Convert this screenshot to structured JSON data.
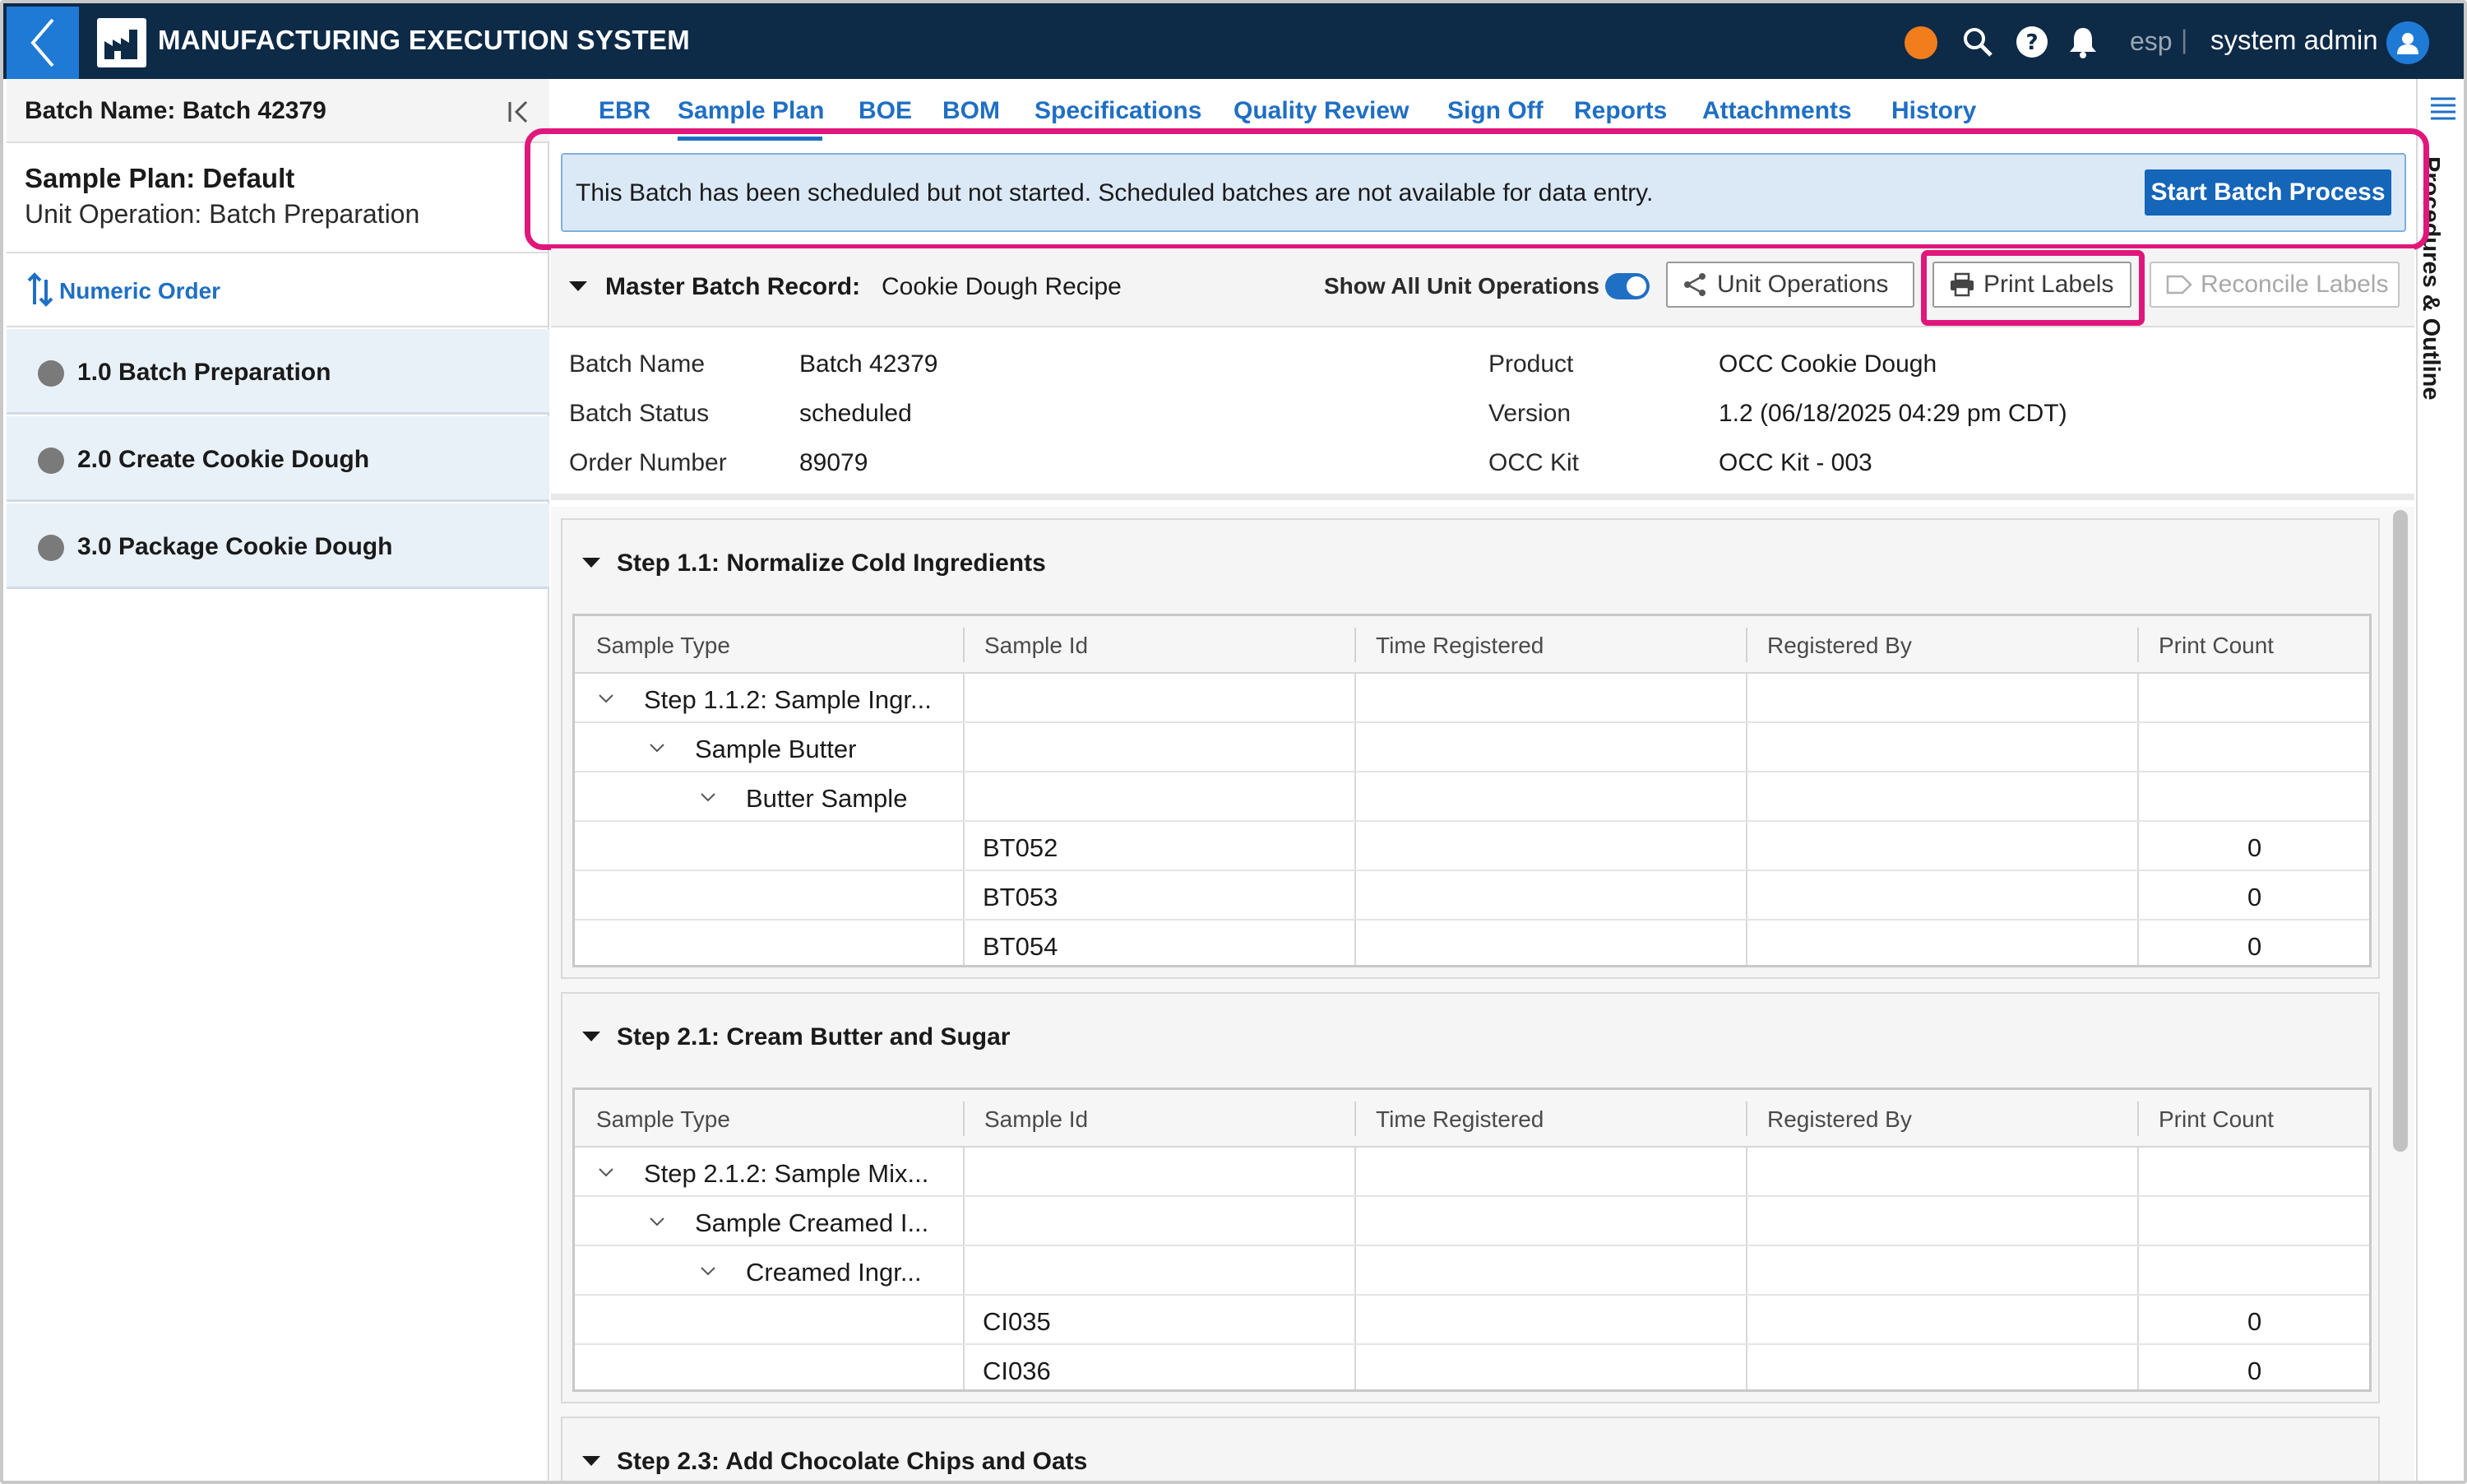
{
  "app": {
    "title": "MANUFACTURING EXECUTION SYSTEM",
    "status_color": "#f27d1d",
    "accent": "#1f6fc4",
    "brand_dark": "#0d2a47"
  },
  "topbar": {
    "language": "esp",
    "separator": "|",
    "user": "system admin",
    "icons": [
      "search-icon",
      "help-icon",
      "bell-icon",
      "user-icon"
    ]
  },
  "sidebar": {
    "batch_name": "Batch Name: Batch 42379",
    "plan_title": "Sample Plan: Default",
    "plan_sub": "Unit Operation: Batch Preparation",
    "order_label": "Numeric Order",
    "operations": [
      {
        "label": "1.0 Batch Preparation"
      },
      {
        "label": "2.0 Create Cookie Dough"
      },
      {
        "label": "3.0 Package Cookie Dough"
      }
    ]
  },
  "tabs": [
    "EBR",
    "Sample Plan",
    "BOE",
    "BOM",
    "Specifications",
    "Quality Review",
    "Sign Off",
    "Reports",
    "Attachments",
    "History"
  ],
  "active_tab": "Sample Plan",
  "alert": {
    "text": "This Batch has been scheduled but not started. Scheduled batches are not available for data entry.",
    "button": "Start Batch Process"
  },
  "mbr": {
    "label": "Master Batch Record:",
    "value": "Cookie Dough Recipe",
    "show_all": "Show All Unit Operations",
    "toggle_on": true,
    "unit_operations": "Unit Operations",
    "print_labels": "Print Labels",
    "reconcile_labels": "Reconcile Labels"
  },
  "details": {
    "batch_name_label": "Batch Name",
    "batch_name": "Batch 42379",
    "batch_status_label": "Batch Status",
    "batch_status": "scheduled",
    "order_number_label": "Order Number",
    "order_number": "89079",
    "product_label": "Product",
    "product": "OCC Cookie Dough",
    "version_label": "Version",
    "version": "1.2 (06/18/2025 04:29 pm CDT)",
    "kit_label": "OCC Kit",
    "kit": "OCC Kit - 003"
  },
  "columns": [
    "Sample Type",
    "Sample Id",
    "Time Registered",
    "Registered By",
    "Print Count"
  ],
  "steps": [
    {
      "title": "Step 1.1: Normalize Cold Ingredients",
      "rows": [
        {
          "type": "Step 1.1.2: Sample Ingr...",
          "id": "",
          "count": ""
        },
        {
          "type": "Sample Butter",
          "id": "",
          "count": ""
        },
        {
          "type": "Butter Sample",
          "id": "",
          "count": ""
        },
        {
          "type": "",
          "id": "BT052",
          "count": "0"
        },
        {
          "type": "",
          "id": "BT053",
          "count": "0"
        },
        {
          "type": "",
          "id": "BT054",
          "count": "0"
        }
      ]
    },
    {
      "title": "Step 2.1: Cream Butter and Sugar",
      "rows": [
        {
          "type": "Step 2.1.2: Sample Mix...",
          "id": "",
          "count": ""
        },
        {
          "type": "Sample Creamed I...",
          "id": "",
          "count": ""
        },
        {
          "type": "Creamed Ingr...",
          "id": "",
          "count": ""
        },
        {
          "type": "",
          "id": "CI035",
          "count": "0"
        },
        {
          "type": "",
          "id": "CI036",
          "count": "0"
        }
      ]
    },
    {
      "title": "Step 2.3: Add Chocolate Chips and Oats"
    }
  ],
  "right_panel": {
    "label": "Procedures & Outline"
  }
}
